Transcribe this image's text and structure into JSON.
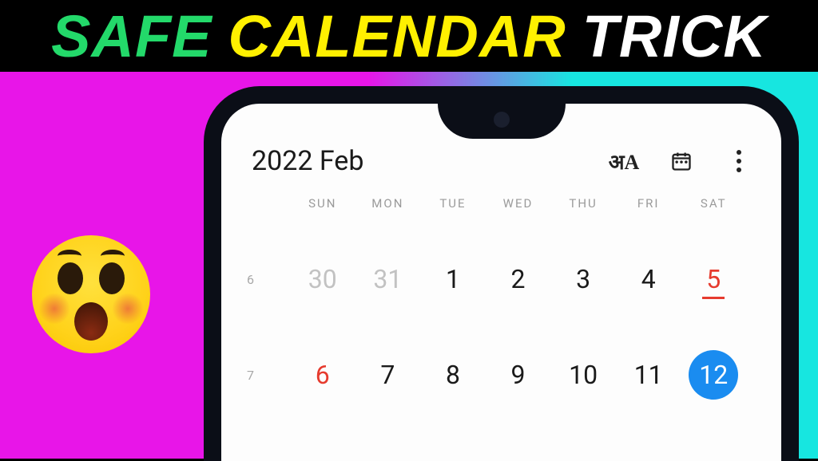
{
  "title": {
    "word1": "SAFE",
    "word2": "CALENDAR",
    "word3": "TRICK"
  },
  "calendar": {
    "header_title": "2022 Feb",
    "icons": {
      "language": "language-icon",
      "today": "calendar-icon",
      "more": "more-icon"
    },
    "weekdays": [
      "SUN",
      "MON",
      "TUE",
      "WED",
      "THU",
      "FRI",
      "SAT"
    ],
    "weeks": [
      {
        "num": "6",
        "days": [
          {
            "d": "30",
            "style": "dim"
          },
          {
            "d": "31",
            "style": "dim"
          },
          {
            "d": "1",
            "style": "normal"
          },
          {
            "d": "2",
            "style": "normal"
          },
          {
            "d": "3",
            "style": "normal"
          },
          {
            "d": "4",
            "style": "normal"
          },
          {
            "d": "5",
            "style": "red-underline"
          }
        ]
      },
      {
        "num": "7",
        "days": [
          {
            "d": "6",
            "style": "red"
          },
          {
            "d": "7",
            "style": "normal"
          },
          {
            "d": "8",
            "style": "normal"
          },
          {
            "d": "9",
            "style": "normal"
          },
          {
            "d": "10",
            "style": "normal"
          },
          {
            "d": "11",
            "style": "normal"
          },
          {
            "d": "12",
            "style": "today"
          }
        ]
      }
    ]
  }
}
